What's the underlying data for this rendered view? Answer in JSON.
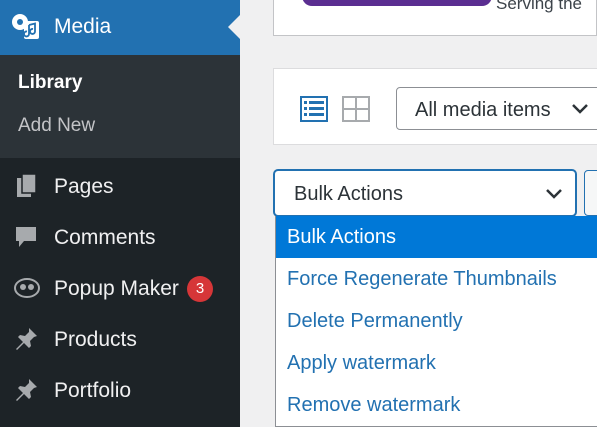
{
  "sidebar": {
    "media": {
      "label": "Media",
      "icon": "media-icon"
    },
    "submenu": [
      {
        "label": "Library",
        "current": true
      },
      {
        "label": "Add New"
      }
    ],
    "items": [
      {
        "label": "Pages",
        "icon": "pages-icon"
      },
      {
        "label": "Comments",
        "icon": "comments-icon"
      },
      {
        "label": "Popup Maker",
        "icon": "popup-maker-icon",
        "badge": "3"
      },
      {
        "label": "Products",
        "icon": "pin-icon"
      },
      {
        "label": "Portfolio",
        "icon": "pin-icon"
      }
    ]
  },
  "top_card": {
    "text": "Serving the"
  },
  "toolbar": {
    "view_modes": [
      "list-view-icon",
      "grid-view-icon"
    ],
    "active_view": "list",
    "filter": {
      "value": "All media items"
    }
  },
  "bulk_actions": {
    "value": "Bulk Actions",
    "options": [
      {
        "label": "Bulk Actions",
        "selected": true
      },
      {
        "label": "Force Regenerate Thumbnails"
      },
      {
        "label": "Delete Permanently"
      },
      {
        "label": "Apply watermark"
      },
      {
        "label": "Remove watermark"
      }
    ]
  },
  "colors": {
    "sidebar_bg": "#1d2327",
    "submenu_bg": "#2c3338",
    "accent": "#2271b1",
    "badge": "#d63638",
    "option_highlight": "#0078d7"
  }
}
